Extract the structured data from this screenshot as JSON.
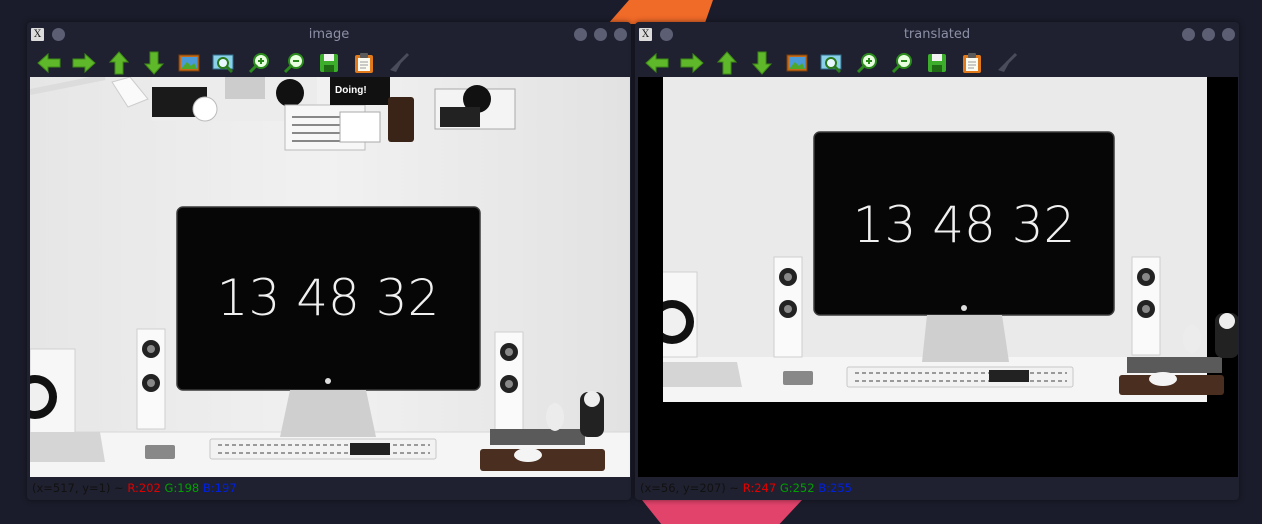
{
  "windows": [
    {
      "title": "image",
      "app_icon": "X",
      "clock_text": "13 48 32",
      "sign_text": "Doing!",
      "status": {
        "coords": "(x=517, y=1) ~",
        "r": "R:202",
        "g": "G:198",
        "b": "B:197"
      }
    },
    {
      "title": "translated",
      "app_icon": "X",
      "clock_text": "13 48 32",
      "sign_text": "",
      "status": {
        "coords": "(x=56, y=207) ~",
        "r": "R:247",
        "g": "G:252",
        "b": "B:255"
      }
    }
  ],
  "toolbar_icons": [
    "arrow-left-icon",
    "arrow-right-icon",
    "arrow-up-icon",
    "arrow-down-icon",
    "image-icon",
    "zoom-fit-icon",
    "zoom-in-icon",
    "zoom-out-icon",
    "save-icon",
    "clipboard-icon",
    "brush-icon"
  ],
  "colors": {
    "background": "#1b1c2b",
    "window": "#1f2130",
    "toolbar_green": "#5eb82a",
    "accent_orange": "#f06a28",
    "accent_pink": "#e2436b"
  }
}
